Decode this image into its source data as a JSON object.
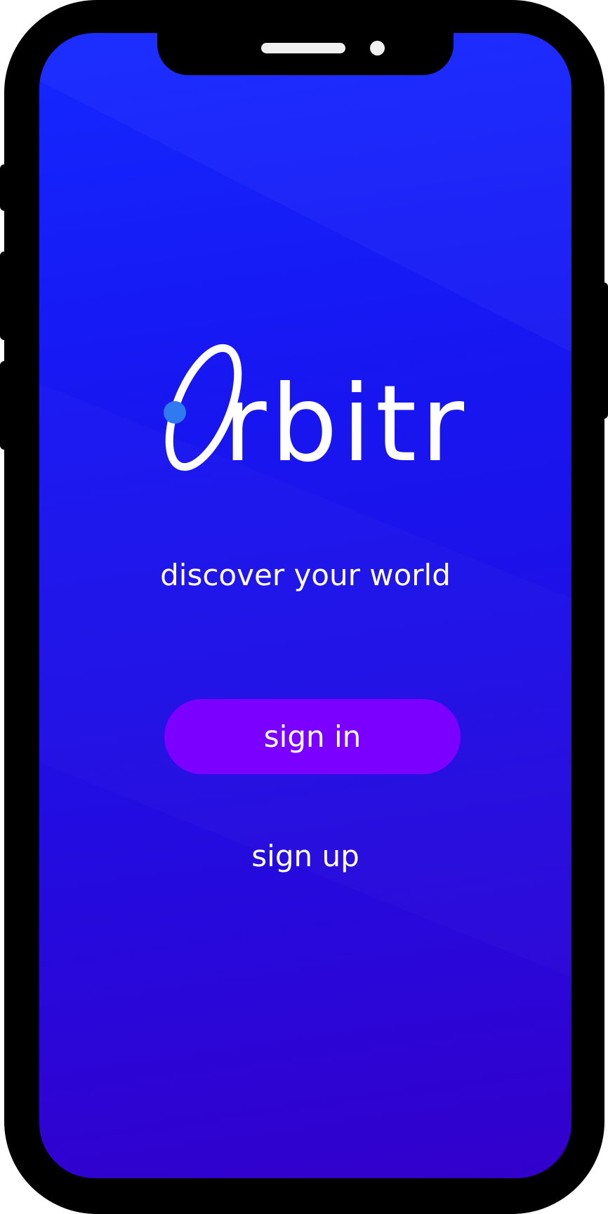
{
  "app": {
    "logo_text": "rbitr",
    "tagline": "discover your world"
  },
  "actions": {
    "sign_in_label": "sign in",
    "sign_up_label": "sign up"
  },
  "colors": {
    "background_top": "#1428ff",
    "background_bottom": "#3300cc",
    "sign_in_button": "#7b00ff",
    "logo_dot": "#2f7af0",
    "text": "#ffffff"
  },
  "icons": {
    "logo_mark": "orbit-ring-icon"
  }
}
